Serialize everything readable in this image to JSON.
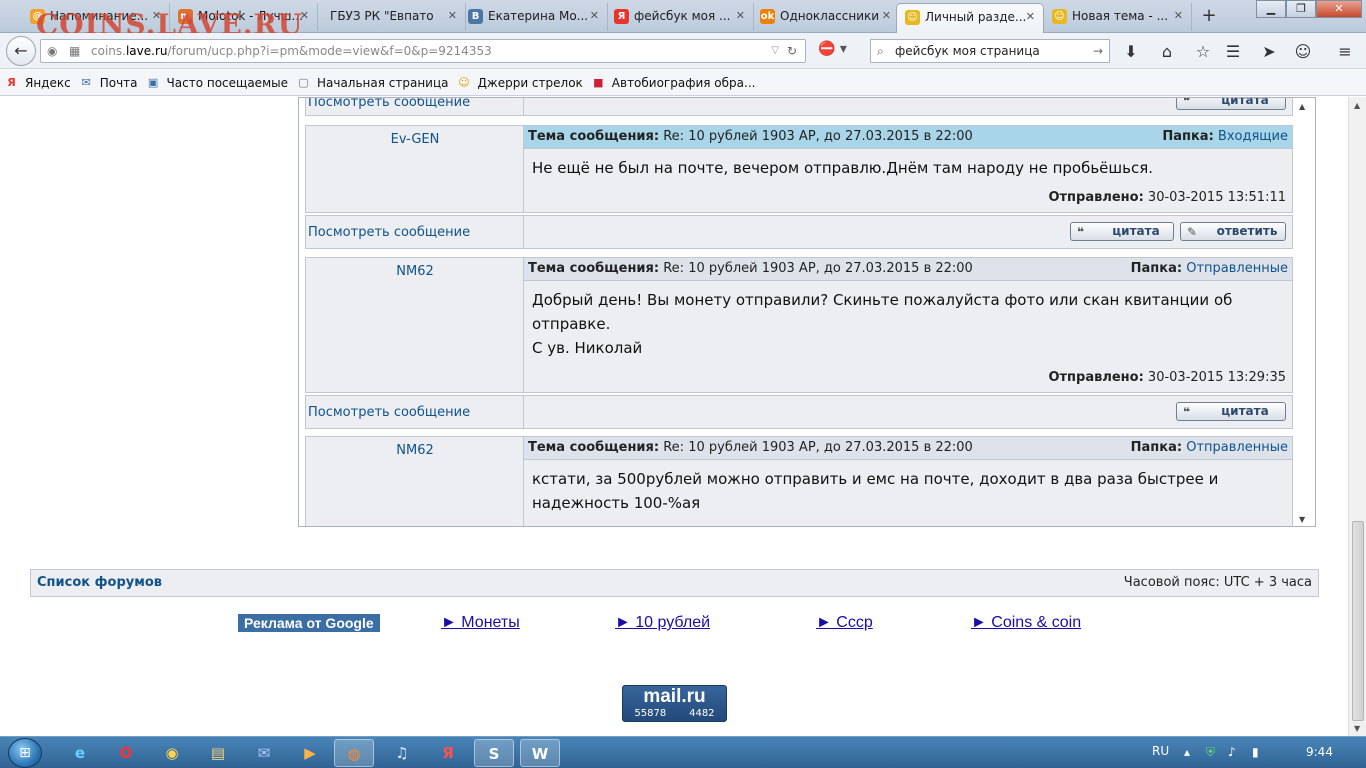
{
  "browser": {
    "watermark": "COINS.LAVE.RU",
    "tabs": [
      {
        "label": "Напоминание...",
        "icon": "@",
        "color": "#f2a12b"
      },
      {
        "label": "Molotok - Лучш...",
        "icon": "m",
        "color": "#e07030"
      },
      {
        "label": "ГБУЗ РК \"Евпатор...",
        "icon": "",
        "color": ""
      },
      {
        "label": "Екатерина Мо...",
        "icon": "В",
        "color": "#4a76a8"
      },
      {
        "label": "фейсбук моя ...",
        "icon": "Я",
        "color": "#e6352b"
      },
      {
        "label": "Одноклассники",
        "icon": "ok",
        "color": "#ee8208"
      },
      {
        "label": "Личный разде...",
        "icon": "☺",
        "color": "#e8b820"
      },
      {
        "label": "Новая тема - ...",
        "icon": "☺",
        "color": "#e8b820"
      }
    ],
    "newtab": "+",
    "url_scheme": "coins.",
    "url_domain": "lave.ru",
    "url_path": "/forum/ucp.php?i=pm&mode=view&f=0&p=9214353",
    "search_value": "фейсбук моя страница",
    "window_min": "▁",
    "window_max": "❐",
    "window_close": "✕"
  },
  "bookmarks": [
    {
      "label": "Яндекс",
      "icon": "Я",
      "color": "#e6352b"
    },
    {
      "label": "Почта",
      "icon": "✉",
      "color": "#3a6ea5"
    },
    {
      "label": "Часто посещаемые",
      "icon": "▣",
      "color": "#3a6ea5"
    },
    {
      "label": "Начальная страница",
      "icon": "▢",
      "color": "#777777"
    },
    {
      "label": "Джерри стрелок",
      "icon": "☺",
      "color": "#d9a400"
    },
    {
      "label": "Автобиография обра...",
      "icon": "■",
      "color": "#cc2233"
    }
  ],
  "pm": {
    "view_label": "Посмотреть сообщение",
    "subject_label": "Тема сообщения:",
    "folder_label": "Папка:",
    "sent_label": "Отправлено:",
    "quote_label": "цитата",
    "reply_label": "ответить",
    "messages": [
      {
        "author": "Ev-GEN",
        "subject": "Re: 10 рублей 1903 АР, до 27.03.2015 в 22:00",
        "folder": "Входящие",
        "body": [
          "Не ещё не был на почте, вечером отправлю.Днём там народу не пробьёшься."
        ],
        "sent": "30-03-2015 13:51:11"
      },
      {
        "author": "NM62",
        "subject": "Re: 10 рублей 1903 АР, до 27.03.2015 в 22:00",
        "folder": "Отправленные",
        "body": [
          "Добрый день! Вы монету отправили? Скиньте пожалуйста фото или скан квитанции об",
          "отправке.",
          "С ув. Николай"
        ],
        "sent": "30-03-2015 13:29:35"
      },
      {
        "author": "NM62",
        "subject": "Re: 10 рублей 1903 АР, до 27.03.2015 в 22:00",
        "folder": "Отправленные",
        "body": [
          "кстати, за 500рублей можно отправить и емс на почте, доходит в два раза быстрее и",
          "надежность 100-%ая"
        ],
        "sent": ""
      }
    ]
  },
  "footer": {
    "forum_list": "Список форумов",
    "timezone": "Часовой пояс: UTC + 3 часа"
  },
  "ads": {
    "label": "Реклама от Google",
    "links": [
      "► Монеты",
      "► 10 рублей",
      "► Ссср",
      "► Coins & coin"
    ]
  },
  "counter": {
    "brand": "mail.ru",
    "count1": "55878",
    "count2": "4482"
  },
  "taskbar": {
    "lang": "RU",
    "clock": "9:44"
  }
}
